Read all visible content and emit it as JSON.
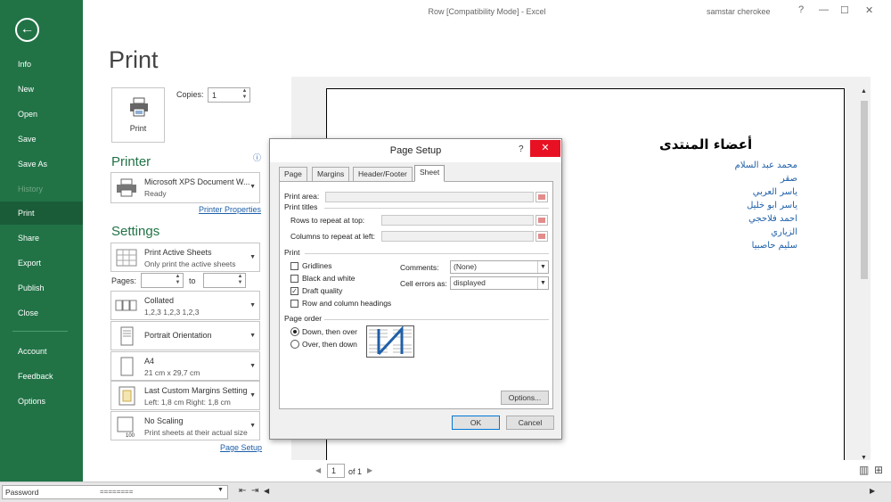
{
  "window": {
    "title": "Row  [Compatibility Mode]  -  Excel",
    "user": "samstar cherokee",
    "controls": [
      "?",
      "—",
      "☐",
      "✕"
    ]
  },
  "nav": {
    "back_icon": "back-arrow-icon",
    "items": [
      {
        "label": "Info",
        "state": "normal"
      },
      {
        "label": "New",
        "state": "normal"
      },
      {
        "label": "Open",
        "state": "normal"
      },
      {
        "label": "Save",
        "state": "normal"
      },
      {
        "label": "Save As",
        "state": "normal"
      },
      {
        "label": "History",
        "state": "disabled"
      },
      {
        "label": "Print",
        "state": "active"
      },
      {
        "label": "Share",
        "state": "normal"
      },
      {
        "label": "Export",
        "state": "normal"
      },
      {
        "label": "Publish",
        "state": "normal"
      },
      {
        "label": "Close",
        "state": "normal"
      },
      {
        "label": "Account",
        "state": "normal"
      },
      {
        "label": "Feedback",
        "state": "normal"
      },
      {
        "label": "Options",
        "state": "normal"
      }
    ]
  },
  "print": {
    "heading": "Print",
    "button_label": "Print",
    "copies_label": "Copies:",
    "copies_value": "1"
  },
  "printer": {
    "heading": "Printer",
    "info_icon": "ⓘ",
    "name": "Microsoft XPS Document W...",
    "status": "Ready",
    "properties_link": "Printer Properties"
  },
  "settings": {
    "heading": "Settings",
    "what": {
      "title": "Print Active Sheets",
      "subtitle": "Only print the active sheets"
    },
    "pages_label": "Pages:",
    "pages_from": "",
    "to_label": "to",
    "pages_to": "",
    "collation": {
      "title": "Collated",
      "subtitle": "1,2,3    1,2,3    1,2,3"
    },
    "orientation": {
      "title": "Portrait Orientation"
    },
    "paper": {
      "title": "A4",
      "subtitle": "21 cm x 29,7 cm"
    },
    "margins": {
      "title": "Last Custom Margins Setting",
      "subtitle": "Left:  1,8 cm    Right:  1,8 cm"
    },
    "scaling": {
      "title": "No Scaling",
      "subtitle": "Print sheets at their actual size",
      "icon_text": "100"
    },
    "page_setup_link": "Page Setup"
  },
  "preview": {
    "sheet_title": "أعضاء المنتدى",
    "members": [
      "محمد عبد السلام",
      "صقر",
      "ياسر العربي",
      "ياسر ابو خليل",
      "احمد فلاحجي",
      "الزياري",
      "سليم حاصبيا"
    ],
    "page_label": "of 1",
    "page_value": "1"
  },
  "dialog": {
    "title": "Page Setup",
    "help": "?",
    "tabs": [
      {
        "label": "Page",
        "selected": false
      },
      {
        "label": "Margins",
        "selected": false
      },
      {
        "label": "Header/Footer",
        "selected": false
      },
      {
        "label": "Sheet",
        "selected": true
      }
    ],
    "print_area_label": "Print area:",
    "print_titles_label": "Print titles",
    "rows_repeat_label": "Rows to repeat at top:",
    "cols_repeat_label": "Columns to repeat at left:",
    "print_section_label": "Print",
    "checkboxes": [
      {
        "label": "Gridlines",
        "checked": false
      },
      {
        "label": "Black and white",
        "checked": false
      },
      {
        "label": "Draft quality",
        "checked": true
      },
      {
        "label": "Row and column headings",
        "checked": false
      }
    ],
    "comments_label": "Comments:",
    "comments_value": "(None)",
    "cell_errors_label": "Cell errors as:",
    "cell_errors_value": "displayed",
    "page_order_label": "Page order",
    "radios": [
      {
        "label": "Down, then over",
        "selected": true
      },
      {
        "label": "Over, then down",
        "selected": false
      }
    ],
    "options_button": "Options...",
    "ok_button": "OK",
    "cancel_button": "Cancel"
  },
  "bottom": {
    "name_box_value": "Password",
    "formula_value": "========"
  },
  "colors": {
    "nav_green": "#217346",
    "link_blue": "#1e5fa8",
    "close_red": "#e81123"
  }
}
